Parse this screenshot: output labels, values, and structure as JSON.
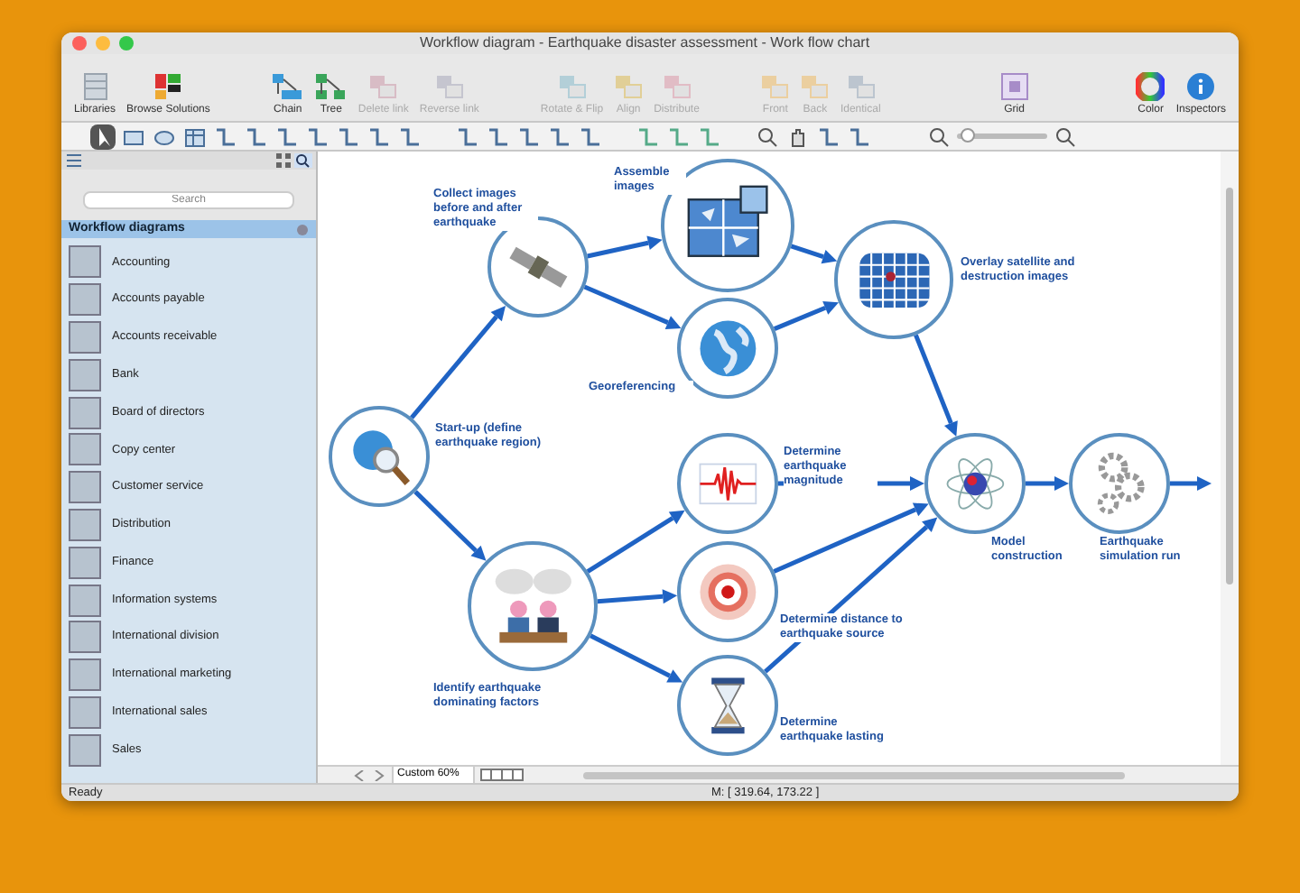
{
  "window": {
    "title": "Workflow diagram - Earthquake disaster assessment - Work flow chart"
  },
  "toolbar": [
    {
      "label": "Libraries",
      "kind": "libraries",
      "disabled": false
    },
    {
      "label": "Browse Solutions",
      "kind": "solutions",
      "disabled": false
    },
    {
      "label": "Chain",
      "kind": "chain",
      "disabled": false
    },
    {
      "label": "Tree",
      "kind": "tree",
      "disabled": false
    },
    {
      "label": "Delete link",
      "kind": "delete",
      "disabled": true
    },
    {
      "label": "Reverse link",
      "kind": "reverse",
      "disabled": true
    },
    {
      "label": "Rotate & Flip",
      "kind": "rotate",
      "disabled": true
    },
    {
      "label": "Align",
      "kind": "align",
      "disabled": true
    },
    {
      "label": "Distribute",
      "kind": "distribute",
      "disabled": true
    },
    {
      "label": "Front",
      "kind": "front",
      "disabled": true
    },
    {
      "label": "Back",
      "kind": "back",
      "disabled": true
    },
    {
      "label": "Identical",
      "kind": "identical",
      "disabled": true
    },
    {
      "label": "Grid",
      "kind": "grid",
      "disabled": false
    },
    {
      "label": "Color",
      "kind": "color",
      "disabled": false
    },
    {
      "label": "Inspectors",
      "kind": "inspectors",
      "disabled": false
    }
  ],
  "zoom_slider": {
    "level": 0.12
  },
  "sidebar": {
    "search": {
      "placeholder": "Search"
    },
    "section": "Workflow diagrams",
    "items": [
      "Accounting",
      "Accounts payable",
      "Accounts receivable",
      "Bank",
      "Board of directors",
      "Copy center",
      "Customer service",
      "Distribution",
      "Finance",
      "Information systems",
      "International division",
      "International marketing",
      "International sales",
      "Sales"
    ]
  },
  "diagram": {
    "nodes": [
      {
        "kind": "satellite",
        "label": "Collect images before and after earthquake"
      },
      {
        "kind": "search-globe",
        "label": "Start-up (define earthquake region)"
      },
      {
        "kind": "puzzle",
        "label": "Assemble images"
      },
      {
        "kind": "globe",
        "label": "Georeferencing"
      },
      {
        "kind": "grid-map",
        "label": "Overlay satellite and destruction images"
      },
      {
        "kind": "meeting",
        "label": "Identify earthquake dominating factors"
      },
      {
        "kind": "seismogram",
        "label": "Determine earthquake magnitude"
      },
      {
        "kind": "target",
        "label": "Determine distance to earthquake source"
      },
      {
        "kind": "hourglass",
        "label": "Determine earthquake lasting"
      },
      {
        "kind": "atom",
        "label": "Model construction"
      },
      {
        "kind": "gears",
        "label": "Earthquake simulation run"
      }
    ]
  },
  "bottom_bar": {
    "zoom": "Custom 60%"
  },
  "status_bar": {
    "status": "Ready",
    "coordinates": "M: [ 319.64, 173.22 ]"
  }
}
